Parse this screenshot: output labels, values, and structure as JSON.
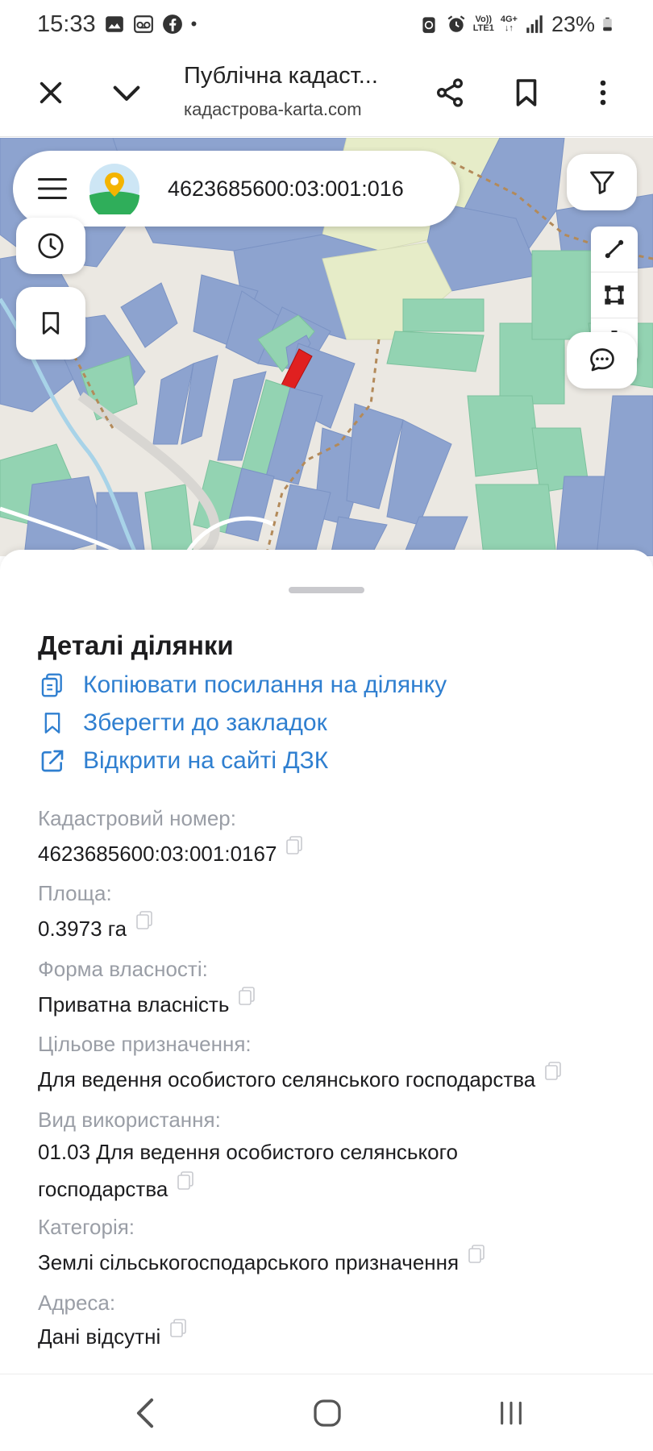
{
  "status_bar": {
    "time": "15:33",
    "dot": "•",
    "volte_line1": "Vo))",
    "volte_line2": "LTE1",
    "net_line1": "4G+",
    "net_line2": "↓↑",
    "battery": "23%"
  },
  "browser": {
    "title": "Публічна кадаст...",
    "url": "кадастрова-karta.com"
  },
  "search": {
    "value": "4623685600:03:001:016"
  },
  "sheet": {
    "title": "Деталі ділянки",
    "actions": [
      {
        "label": "Копіювати посилання на ділянку"
      },
      {
        "label": "Зберегти до закладок"
      },
      {
        "label": "Відкрити на сайті ДЗК"
      }
    ],
    "fields": [
      {
        "label": "Кадастровий номер:",
        "value": "4623685600:03:001:0167"
      },
      {
        "label": "Площа:",
        "value": "0.3973 га"
      },
      {
        "label": "Форма власності:",
        "value": "Приватна власність"
      },
      {
        "label": "Цільове призначення:",
        "value": "Для ведення особистого селянського господарства"
      },
      {
        "label": "Вид використання:",
        "value": "01.03 Для ведення особистого селянського господарства"
      },
      {
        "label": "Категорія:",
        "value": "Землі сільськогосподарського призначення"
      },
      {
        "label": "Адреса:",
        "value": "Дані відсутні"
      }
    ]
  },
  "colors": {
    "accent": "#2f7fd0",
    "parcel_blue": "#8da3cf",
    "parcel_green": "#93d3b2",
    "parcel_yellow": "#e6ecc8",
    "selected_parcel": "#e02020"
  },
  "icons": [
    "image-icon",
    "voicemail-icon",
    "facebook-icon",
    "battery-saver-icon",
    "alarm-icon",
    "signal-icon",
    "battery-icon",
    "close-icon",
    "chevron-down-icon",
    "share-icon",
    "bookmark-icon",
    "more-vert-icon",
    "menu-icon",
    "map-logo-icon",
    "filter-icon",
    "history-icon",
    "line-tool-icon",
    "polygon-tool-icon",
    "trash-icon",
    "chat-icon",
    "copy-link-icon",
    "external-link-icon",
    "copy-icon",
    "nav-back-icon",
    "nav-home-icon",
    "nav-recents-icon"
  ]
}
